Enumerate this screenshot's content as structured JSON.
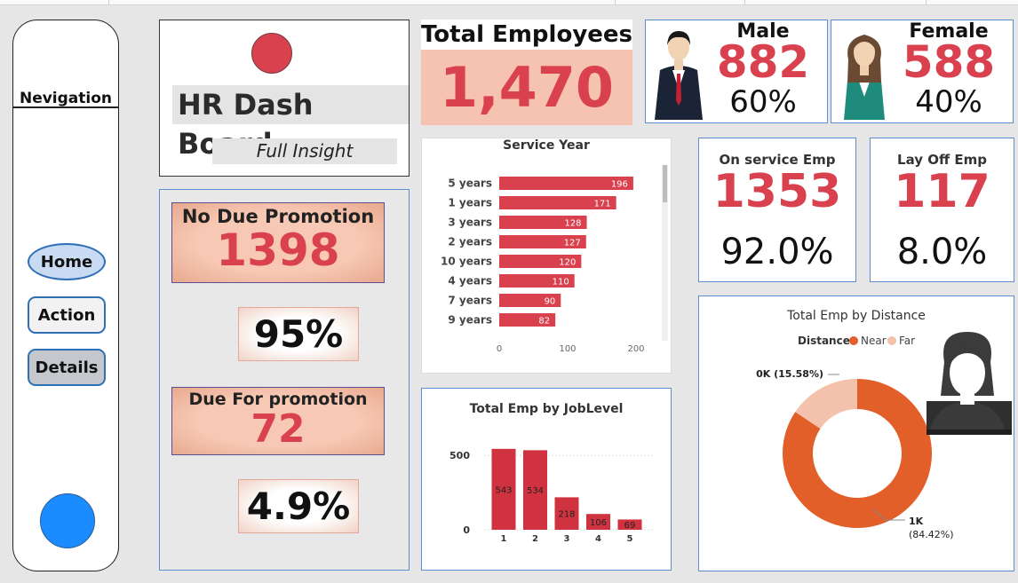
{
  "nav": {
    "title": "Nevigation",
    "home": "Home",
    "action": "Action",
    "details": "Details"
  },
  "hr": {
    "title": "HR Dash Board",
    "subtitle": "Full Insight"
  },
  "promotion": {
    "no_due_label": "No Due Promotion",
    "no_due_value": "1398",
    "no_due_pct": "95%",
    "due_label": "Due For promotion",
    "due_value": "72",
    "due_pct": "4.9%"
  },
  "total": {
    "label": "Total Employees",
    "value": "1,470"
  },
  "male": {
    "label": "Male",
    "value": "882",
    "pct": "60%"
  },
  "female": {
    "label": "Female",
    "value": "588",
    "pct": "40%"
  },
  "on_service": {
    "label": "On service Emp",
    "value": "1353",
    "pct": "92.0%"
  },
  "lay_off": {
    "label": "Lay Off Emp",
    "value": "117",
    "pct": "8.0%"
  },
  "colors": {
    "accent_red": "#d9414e",
    "bar_red": "#d0333f",
    "peach": "#f5c3b0",
    "near": "#e35f2a",
    "far": "#f4c2ac",
    "nav_dot": "#1a8cff"
  },
  "chart_data": [
    {
      "type": "bar",
      "title": "Service Year",
      "orientation": "horizontal",
      "categories": [
        "5 years",
        "1 years",
        "3 years",
        "2 years",
        "10 years",
        "4 years",
        "7 years",
        "9 years"
      ],
      "values": [
        196,
        171,
        128,
        127,
        120,
        110,
        90,
        82
      ],
      "xticks": [
        "0",
        "100",
        "200"
      ],
      "xlim": [
        0,
        200
      ]
    },
    {
      "type": "bar",
      "title": "Total Emp by JobLevel",
      "categories": [
        "1",
        "2",
        "3",
        "4",
        "5"
      ],
      "values": [
        543,
        534,
        218,
        106,
        69
      ],
      "yticks": [
        "0",
        "500"
      ],
      "ylim": [
        0,
        560
      ]
    },
    {
      "type": "pie",
      "title": "Total Emp by Distance",
      "legend_title": "Distance",
      "legend_position": "top",
      "series": [
        {
          "name": "Near",
          "label": "1K",
          "pct_label": "(84.42%)",
          "value": 84.42
        },
        {
          "name": "Far",
          "label": "0K (15.58%)",
          "value": 15.58
        }
      ]
    }
  ]
}
